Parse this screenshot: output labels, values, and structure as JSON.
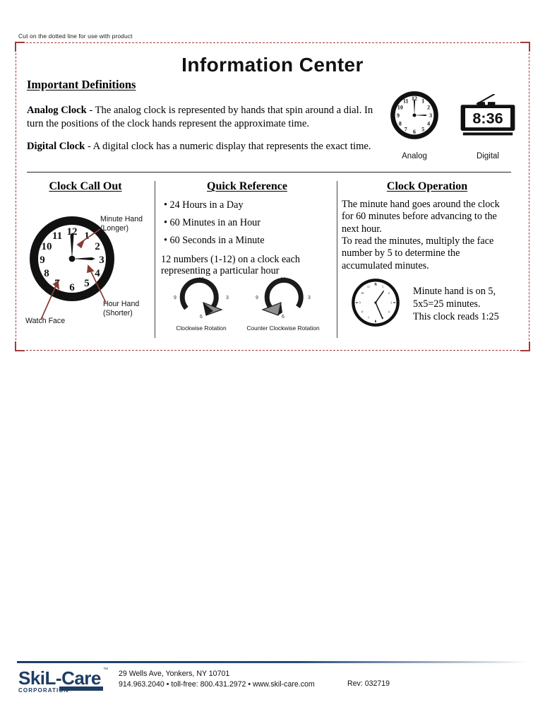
{
  "cut_note": "Cut on the dotted line for use with product",
  "title": "Information Center",
  "definitions": {
    "heading": "Important Definitions",
    "items": [
      {
        "term": "Analog Clock",
        "dash": " - ",
        "text": "The analog clock is represented by hands that spin around a dial. In turn the positions of the clock hands represent the approximate time."
      },
      {
        "term": "Digital Clock",
        "dash": " - ",
        "text": "A digital clock has a numeric display that represents the exact time."
      }
    ]
  },
  "figures": {
    "analog": {
      "caption": "Analog",
      "hour": 3,
      "minute": 0,
      "numerals": [
        "12",
        "1",
        "2",
        "3",
        "4",
        "5",
        "6",
        "7",
        "8",
        "9",
        "10",
        "11"
      ]
    },
    "digital": {
      "caption": "Digital",
      "display": "8:36"
    }
  },
  "columns": {
    "call_out": {
      "heading": "Clock Call Out",
      "labels": {
        "minute": "Minute Hand\n(Longer)",
        "minute_line1": "Minute Hand",
        "minute_line2": "(Longer)",
        "hour_line1": "Hour Hand",
        "hour_line2": "(Shorter)",
        "face": "Watch Face"
      },
      "clock": {
        "hour": 3,
        "minute": 0
      },
      "arrow_color": "#8a3a34"
    },
    "quick_reference": {
      "heading": "Quick Reference",
      "bullets": [
        "• 24 Hours in a Day",
        "• 60 Minutes in an Hour",
        "• 60 Seconds in a Minute"
      ],
      "note": "12 numbers (1-12) on a clock each representing a particular hour",
      "rotations": [
        {
          "label": "Clockwise Rotation",
          "ticks": [
            "12",
            "3",
            "6",
            "9"
          ],
          "direction": "clockwise"
        },
        {
          "label": "Counter Clockwise Rotation",
          "ticks": [
            "12",
            "3",
            "6",
            "9"
          ],
          "direction": "counter-clockwise"
        }
      ]
    },
    "operation": {
      "heading": "Clock Operation",
      "paragraph": "The minute hand goes around the clock for 60 minutes before advancing to the next hour.\nTo read the minutes, multiply the face number by 5 to determine the accumulated minutes.",
      "para_line1": "The minute hand goes around the clock for 60 minutes before advancing to the next hour.",
      "para_line2": "To read the minutes, multiply the face number by 5 to determine the accumulated minutes.",
      "example_note_line1": "Minute hand is on 5,",
      "example_note_line2": "5x5=25 minutes.",
      "example_note_line3": "This clock reads 1:25",
      "example_clock": {
        "hour": 1,
        "minute": 25,
        "reads": "1:25"
      }
    }
  },
  "footer": {
    "brand": "SkiL-Care",
    "brand_sub": "CORPORATION",
    "trademark": "™",
    "address": "29 Wells Ave, Yonkers, NY 10701",
    "contact": "914.963.2040 • toll-free: 800.431.2972 • www.skil-care.com",
    "revision": "Rev: 032719",
    "brand_color": "#1e3d63"
  },
  "colors": {
    "cut_line": "#a33a3a",
    "ink": "#111111"
  }
}
